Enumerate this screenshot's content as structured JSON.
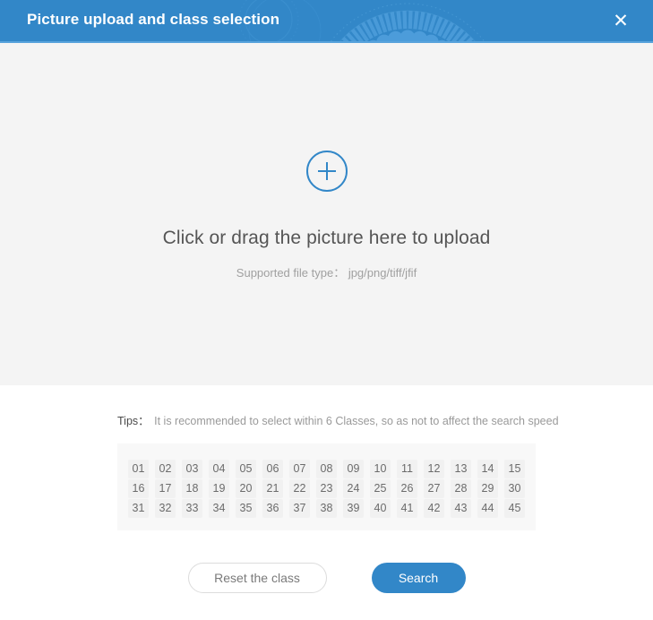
{
  "window": {
    "title": "Picture upload and class selection",
    "close_icon": "close-icon",
    "close_glyph": "✕",
    "header_color": "#3287c8",
    "header_border_color": "#58a3dc"
  },
  "upload": {
    "plus_icon": "plus-circle-icon",
    "main_text": "Click or drag the picture here to upload",
    "sub_text": "Supported file type： jpg/png/tiff/jfif",
    "background_color": "#f4f4f4",
    "accent_color": "#3287c8"
  },
  "tips": {
    "label": "Tips：",
    "text": "It is recommended to select within 6 Classes, so as not to affect the search speed"
  },
  "classes": {
    "rows": [
      [
        "01",
        "02",
        "03",
        "04",
        "05",
        "06",
        "07",
        "08",
        "09",
        "10",
        "11",
        "12",
        "13",
        "14",
        "15"
      ],
      [
        "16",
        "17",
        "18",
        "19",
        "20",
        "21",
        "22",
        "23",
        "24",
        "25",
        "26",
        "27",
        "28",
        "29",
        "30"
      ],
      [
        "31",
        "32",
        "33",
        "34",
        "35",
        "36",
        "37",
        "38",
        "39",
        "40",
        "41",
        "42",
        "43",
        "44",
        "45"
      ]
    ],
    "chip_color": "#f1f1f1",
    "panel_color": "#f8f8f8"
  },
  "actions": {
    "reset_label": "Reset the class",
    "search_label": "Search",
    "search_color": "#3287c8"
  }
}
